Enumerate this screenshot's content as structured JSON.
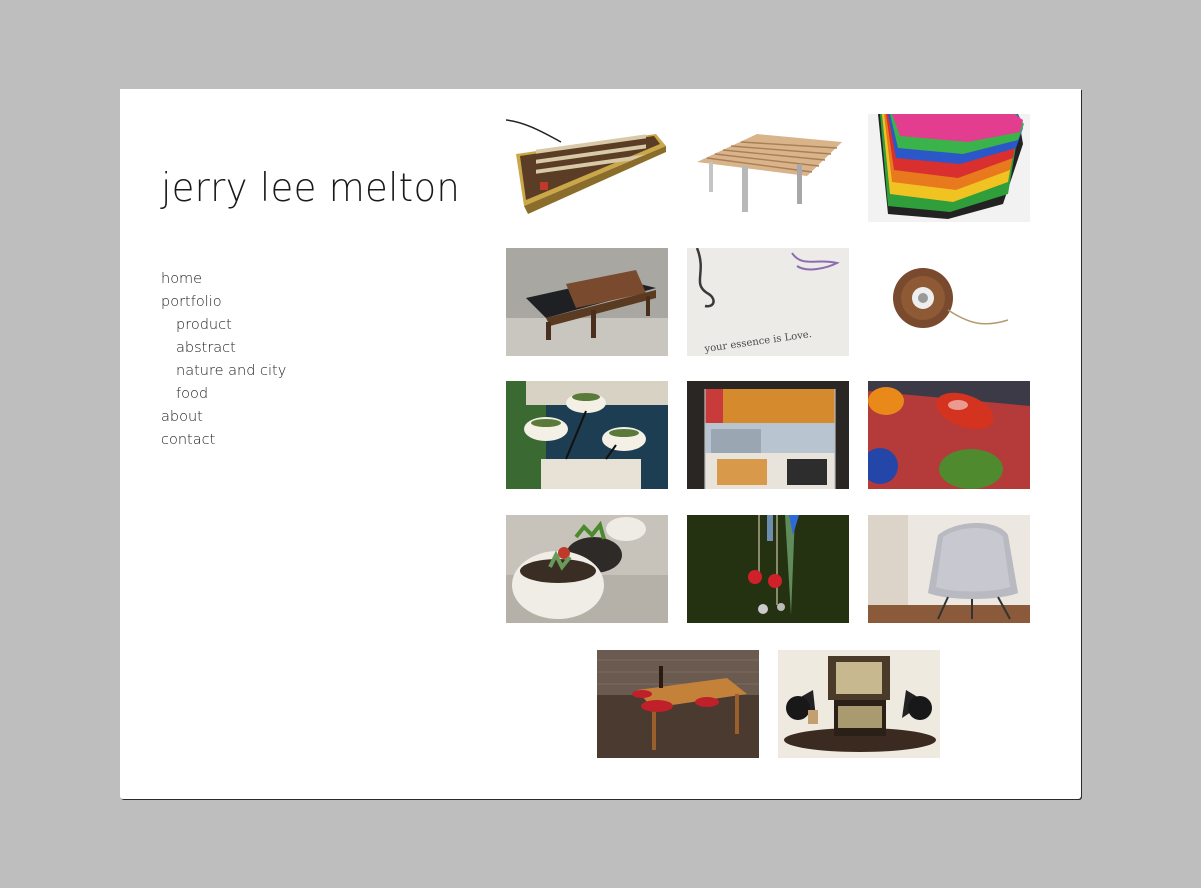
{
  "site": {
    "title": "jerry lee melton"
  },
  "nav": {
    "home": "home",
    "portfolio": "portfolio",
    "product": "product",
    "abstract": "abstract",
    "nature_city": "nature and city",
    "food": "food",
    "about": "about",
    "contact": "contact"
  },
  "gallery": {
    "items": [
      {
        "subject": "brass typewriter keyboard"
      },
      {
        "subject": "slatted wood bench"
      },
      {
        "subject": "stacked colorful bowls"
      },
      {
        "subject": "leather lounge daybed"
      },
      {
        "subject": "ink love letter card"
      },
      {
        "subject": "wooden yo-yo"
      },
      {
        "subject": "planter bowls by pool"
      },
      {
        "subject": "storage unit cabinet"
      },
      {
        "subject": "glass beads on red"
      },
      {
        "subject": "succulent planters"
      },
      {
        "subject": "hanging glass jewelry"
      },
      {
        "subject": "molded shell chair"
      },
      {
        "subject": "dining table red chairs"
      },
      {
        "subject": "gramophone typewriter desk"
      }
    ]
  }
}
